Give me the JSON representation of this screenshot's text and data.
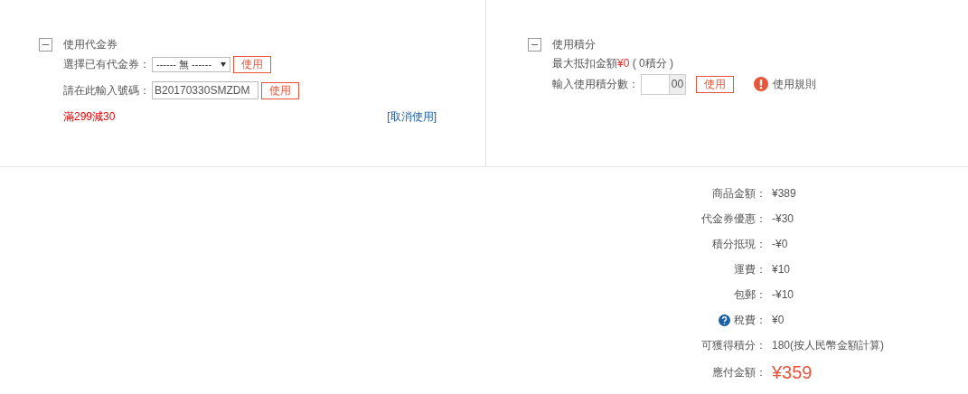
{
  "coupon_panel": {
    "title": "使用代金券",
    "expanded": true,
    "select_label": "選擇已有代金券：",
    "select_value": "------ 無 ------",
    "select_button": "使用",
    "code_label": "請在此輸入號碼：",
    "code_value": "B20170330SMZDM",
    "code_button": "使用",
    "applied": "滿299減30",
    "cancel_link": "[取消使用]"
  },
  "points_panel": {
    "title": "使用積分",
    "expanded": true,
    "max_label": "最大抵扣金額",
    "max_value": "¥0",
    "max_points": "( 0積分 )",
    "input_label": "輸入使用積分數：",
    "input_suffix": "00",
    "use_button": "使用",
    "rules_link": "使用規則"
  },
  "summary": [
    {
      "kind": "plain",
      "label": "商品金額：",
      "value": "¥389"
    },
    {
      "kind": "plain",
      "label": "代金券優惠：",
      "value": "-¥30"
    },
    {
      "kind": "plain",
      "label": "積分抵現：",
      "value": "-¥0"
    },
    {
      "kind": "plain",
      "label": "運費：",
      "value": "¥10"
    },
    {
      "kind": "plain",
      "label": "包郵：",
      "value": "-¥10"
    },
    {
      "kind": "help",
      "label": "稅費：",
      "value": "¥0"
    },
    {
      "kind": "plain",
      "label": "可獲得積分：",
      "value": "180(按人民幣金額計算)"
    },
    {
      "kind": "total",
      "label": "應付金額：",
      "value": "¥359"
    }
  ]
}
